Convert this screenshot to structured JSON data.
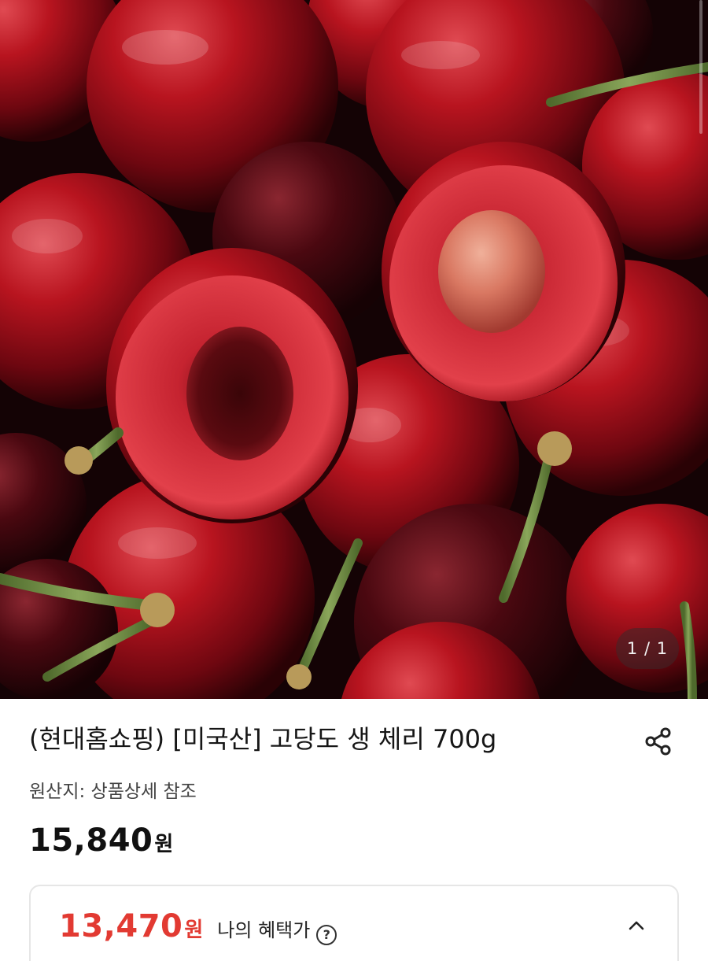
{
  "hero_image": {
    "alt_icon": "product-photo-cherries",
    "counter": "1 / 1"
  },
  "product": {
    "title": "(현대홈쇼핑) [미국산] 고당도 생 체리 700g",
    "origin": "원산지: 상품상세 참조",
    "price": "15,840",
    "price_unit": "원"
  },
  "benefit": {
    "price": "13,470",
    "price_unit": "원",
    "label": "나의 혜택가",
    "help_glyph": "?",
    "accent_color": "#e23a32"
  },
  "icons": {
    "share": "share-icon",
    "help": "question-circle-icon",
    "collapse": "chevron-up-icon"
  }
}
